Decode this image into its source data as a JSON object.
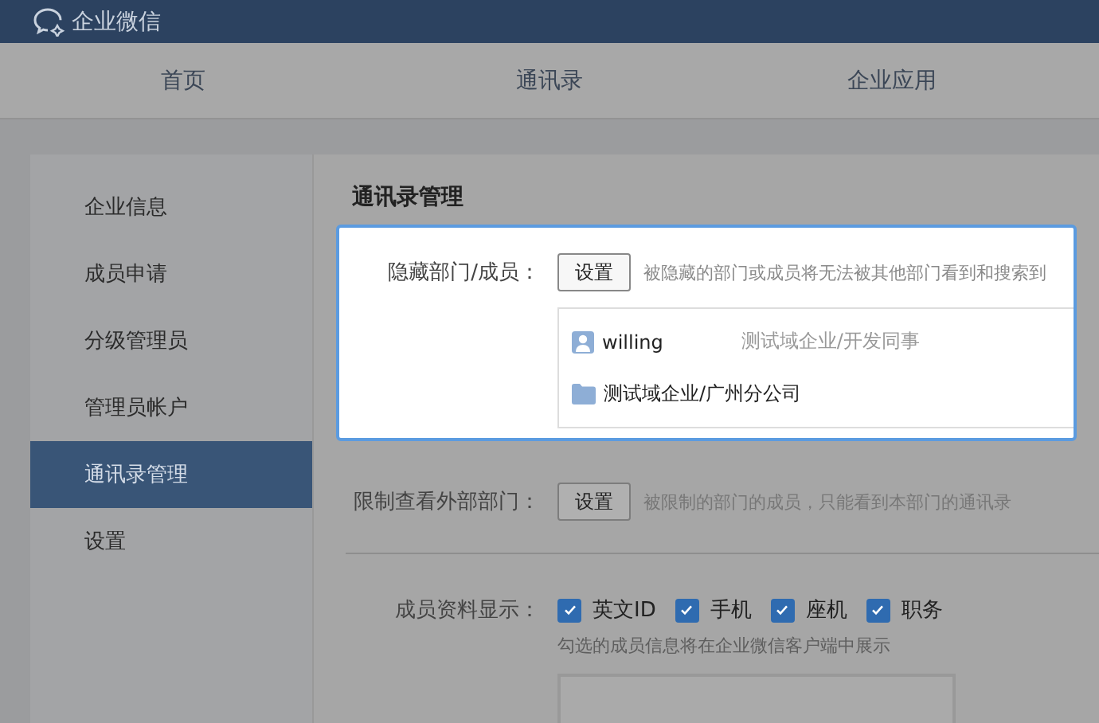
{
  "app": {
    "title": "企业微信"
  },
  "nav": [
    {
      "label": "首页",
      "selected": false
    },
    {
      "label": "通讯录",
      "selected": false
    },
    {
      "label": "企业应用",
      "selected": false
    }
  ],
  "sidebar": {
    "items": [
      {
        "label": "企业信息",
        "selected": false
      },
      {
        "label": "成员申请",
        "selected": false
      },
      {
        "label": "分级管理员",
        "selected": false
      },
      {
        "label": "管理员帐户",
        "selected": false
      },
      {
        "label": "通讯录管理",
        "selected": true
      },
      {
        "label": "设置",
        "selected": false
      }
    ]
  },
  "section_title": "通讯录管理",
  "settings": [
    {
      "label": "隐藏部门/成员：",
      "button": "设置",
      "hint": "被隐藏的部门或成员将无法被其他部门看到和搜索到",
      "highlighted": true,
      "entries": [
        {
          "kind": "member",
          "name": "willing",
          "path": "测试域企业/开发同事"
        },
        {
          "kind": "department",
          "name": "测试域企业/广州分公司"
        }
      ]
    },
    {
      "label": "限制查看外部部门：",
      "button": "设置",
      "hint": "被限制的部门的成员，只能看到本部门的通讯录",
      "highlighted": false
    }
  ],
  "profile_display": {
    "label": "成员资料显示：",
    "options": [
      {
        "label": "英文ID",
        "checked": true
      },
      {
        "label": "手机",
        "checked": true
      },
      {
        "label": "座机",
        "checked": true
      },
      {
        "label": "职务",
        "checked": true
      }
    ],
    "hint": "勾选的成员信息将在企业微信客户端中展示"
  }
}
